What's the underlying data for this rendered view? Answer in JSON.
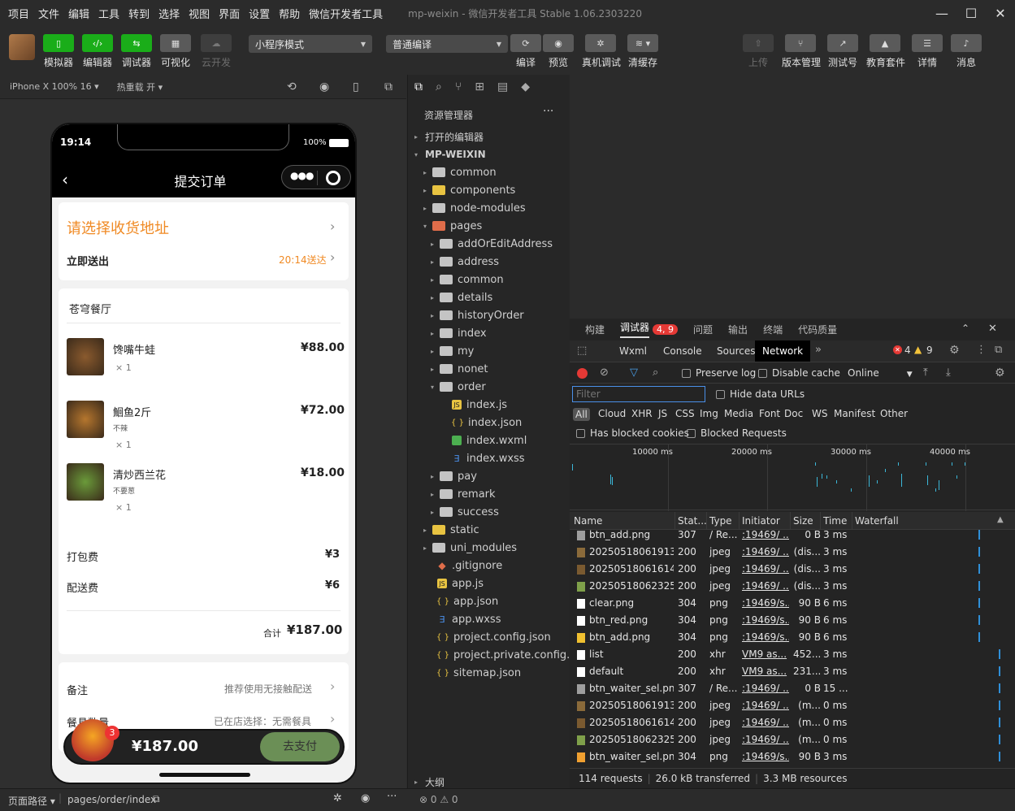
{
  "titlebar": {
    "menus": [
      "项目",
      "文件",
      "编辑",
      "工具",
      "转到",
      "选择",
      "视图",
      "界面",
      "设置",
      "帮助",
      "微信开发者工具"
    ],
    "window_title": "mp-weixin - 微信开发者工具 Stable 1.06.2303220"
  },
  "toolbar": {
    "simulator": "模拟器",
    "editor": "编辑器",
    "debugger": "调试器",
    "visual": "可视化",
    "cloud": "云开发",
    "mode_select": "小程序模式",
    "compile_select": "普通编译",
    "compile": "编译",
    "preview": "预览",
    "remote_debug": "真机调试",
    "clear_cache": "清缓存",
    "upload": "上传",
    "version": "版本管理",
    "test_account": "测试号",
    "edu": "教育套件",
    "details": "详情",
    "messages": "消息"
  },
  "simbar": {
    "device": "iPhone X 100% 16",
    "hot_reload": "热重载 开"
  },
  "phone": {
    "time": "19:14",
    "battery": "100%",
    "nav_title": "提交订单",
    "address_prompt": "请选择收货地址",
    "delivery_label": "立即送出",
    "delivery_time": "20:14送达",
    "restaurant": "苍穹餐厅",
    "items": [
      {
        "name": "馋嘴牛蛙",
        "spec": "",
        "qty": "× 1",
        "price": "¥88.00"
      },
      {
        "name": "鮰鱼2斤",
        "spec": "不辣",
        "qty": "× 1",
        "price": "¥72.00"
      },
      {
        "name": "清炒西兰花",
        "spec": "不要葱",
        "qty": "× 1",
        "price": "¥18.00"
      }
    ],
    "pack_fee_label": "打包费",
    "pack_fee": "¥3",
    "delivery_fee_label": "配送费",
    "delivery_fee": "¥6",
    "total_label": "合计",
    "total": "¥187.00",
    "remark_label": "备注",
    "remark_value": "推荐使用无接触配送",
    "tableware_label": "餐具数量",
    "tableware_value": "已在店选择：无需餐具",
    "cart_badge": "3",
    "cart_total": "¥187.00",
    "pay_button": "去支付"
  },
  "explorer": {
    "header": "资源管理器",
    "open_editors": "打开的编辑器",
    "root": "MP-WEIXIN",
    "outline": "大纲",
    "rows": [
      {
        "label": "common",
        "depth": 1,
        "type": "folder",
        "arrow": "▸"
      },
      {
        "label": "components",
        "depth": 1,
        "type": "folder-y",
        "arrow": "▸"
      },
      {
        "label": "node-modules",
        "depth": 1,
        "type": "folder",
        "arrow": "▸"
      },
      {
        "label": "pages",
        "depth": 1,
        "type": "folder-r",
        "arrow": "▾"
      },
      {
        "label": "addOrEditAddress",
        "depth": 2,
        "type": "folder",
        "arrow": "▸"
      },
      {
        "label": "address",
        "depth": 2,
        "type": "folder",
        "arrow": "▸"
      },
      {
        "label": "common",
        "depth": 2,
        "type": "folder",
        "arrow": "▸"
      },
      {
        "label": "details",
        "depth": 2,
        "type": "folder",
        "arrow": "▸"
      },
      {
        "label": "historyOrder",
        "depth": 2,
        "type": "folder",
        "arrow": "▸"
      },
      {
        "label": "index",
        "depth": 2,
        "type": "folder",
        "arrow": "▸"
      },
      {
        "label": "my",
        "depth": 2,
        "type": "folder",
        "arrow": "▸"
      },
      {
        "label": "nonet",
        "depth": 2,
        "type": "folder",
        "arrow": "▸"
      },
      {
        "label": "order",
        "depth": 2,
        "type": "folder",
        "arrow": "▾"
      },
      {
        "label": "index.js",
        "depth": 3,
        "type": "js",
        "arrow": ""
      },
      {
        "label": "index.json",
        "depth": 3,
        "type": "json",
        "arrow": ""
      },
      {
        "label": "index.wxml",
        "depth": 3,
        "type": "wxml",
        "arrow": ""
      },
      {
        "label": "index.wxss",
        "depth": 3,
        "type": "wxss",
        "arrow": ""
      },
      {
        "label": "pay",
        "depth": 2,
        "type": "folder",
        "arrow": "▸"
      },
      {
        "label": "remark",
        "depth": 2,
        "type": "folder",
        "arrow": "▸"
      },
      {
        "label": "success",
        "depth": 2,
        "type": "folder",
        "arrow": "▸"
      },
      {
        "label": "static",
        "depth": 1,
        "type": "folder-y",
        "arrow": "▸"
      },
      {
        "label": "uni_modules",
        "depth": 1,
        "type": "folder",
        "arrow": "▸"
      },
      {
        "label": ".gitignore",
        "depth": 1,
        "type": "git",
        "arrow": ""
      },
      {
        "label": "app.js",
        "depth": 1,
        "type": "js",
        "arrow": ""
      },
      {
        "label": "app.json",
        "depth": 1,
        "type": "json",
        "arrow": ""
      },
      {
        "label": "app.wxss",
        "depth": 1,
        "type": "wxss",
        "arrow": ""
      },
      {
        "label": "project.config.json",
        "depth": 1,
        "type": "json",
        "arrow": ""
      },
      {
        "label": "project.private.config.js...",
        "depth": 1,
        "type": "json",
        "arrow": ""
      },
      {
        "label": "sitemap.json",
        "depth": 1,
        "type": "json",
        "arrow": ""
      }
    ]
  },
  "devtools": {
    "panel_tabs": [
      "构建",
      "调试器",
      "问题",
      "输出",
      "终端",
      "代码质量"
    ],
    "debugger_badge": "4, 9",
    "tabs": [
      "Wxml",
      "Console",
      "Sources",
      "Network"
    ],
    "error_count": "4",
    "warning_count": "9",
    "preserve_log": "Preserve log",
    "disable_cache": "Disable cache",
    "throttle": "Online",
    "filter_placeholder": "Filter",
    "hide_data_urls": "Hide data URLs",
    "types": [
      "All",
      "Cloud",
      "XHR",
      "JS",
      "CSS",
      "Img",
      "Media",
      "Font",
      "Doc",
      "WS",
      "Manifest",
      "Other"
    ],
    "has_blocked_cookies": "Has blocked cookies",
    "blocked_requests": "Blocked Requests",
    "timeline_ticks": [
      "10000 ms",
      "20000 ms",
      "30000 ms",
      "40000 ms"
    ],
    "columns": [
      "Name",
      "Stat...",
      "Type",
      "Initiator",
      "Size",
      "Time",
      "Waterfall"
    ],
    "rows": [
      {
        "name": "btn_add.png",
        "status": "307",
        "type": "/ Re...",
        "initiator": ":19469/ ...",
        "size": "0 B",
        "time": "3 ms",
        "color": "#9e9e9e"
      },
      {
        "name": "20250518061913...",
        "status": "200",
        "type": "jpeg",
        "initiator": ":19469/ ...",
        "size": "(dis...",
        "time": "3 ms",
        "color": "#8a6a3a"
      },
      {
        "name": "20250518061614...",
        "status": "200",
        "type": "jpeg",
        "initiator": ":19469/ ...",
        "size": "(dis...",
        "time": "3 ms",
        "color": "#7a5a30"
      },
      {
        "name": "20250518062325...",
        "status": "200",
        "type": "jpeg",
        "initiator": ":19469/ ...",
        "size": "(dis...",
        "time": "3 ms",
        "color": "#7fa04a"
      },
      {
        "name": "clear.png",
        "status": "304",
        "type": "png",
        "initiator": ":19469/s...",
        "size": "90 B",
        "time": "6 ms",
        "color": "#ffffff"
      },
      {
        "name": "btn_red.png",
        "status": "304",
        "type": "png",
        "initiator": ":19469/s...",
        "size": "90 B",
        "time": "6 ms",
        "color": "#ffffff"
      },
      {
        "name": "btn_add.png",
        "status": "304",
        "type": "png",
        "initiator": ":19469/s...",
        "size": "90 B",
        "time": "6 ms",
        "color": "#f0c030"
      },
      {
        "name": "list",
        "status": "200",
        "type": "xhr",
        "initiator": "VM9 as...",
        "size": "452...",
        "time": "3 ms",
        "color": "#ffffff"
      },
      {
        "name": "default",
        "status": "200",
        "type": "xhr",
        "initiator": "VM9 as...",
        "size": "231...",
        "time": "3 ms",
        "color": "#ffffff"
      },
      {
        "name": "btn_waiter_sel.png",
        "status": "307",
        "type": "/ Re...",
        "initiator": ":19469/ ...",
        "size": "0 B",
        "time": "15 ...",
        "color": "#9e9e9e"
      },
      {
        "name": "20250518061913...",
        "status": "200",
        "type": "jpeg",
        "initiator": ":19469/ ...",
        "size": "(m...",
        "time": "0 ms",
        "color": "#8a6a3a"
      },
      {
        "name": "20250518061614...",
        "status": "200",
        "type": "jpeg",
        "initiator": ":19469/ ...",
        "size": "(m...",
        "time": "0 ms",
        "color": "#7a5a30"
      },
      {
        "name": "20250518062325...",
        "status": "200",
        "type": "jpeg",
        "initiator": ":19469/ ...",
        "size": "(m...",
        "time": "0 ms",
        "color": "#7fa04a"
      },
      {
        "name": "btn_waiter_sel.png",
        "status": "304",
        "type": "png",
        "initiator": ":19469/s...",
        "size": "90 B",
        "time": "3 ms",
        "color": "#f0a030"
      }
    ],
    "summary_requests": "114 requests",
    "summary_transferred": "26.0 kB transferred",
    "summary_resources": "3.3 MB resources"
  },
  "footer": {
    "page_path_label": "页面路径",
    "page_path": "pages/order/index",
    "errors": "0",
    "warnings": "0"
  }
}
